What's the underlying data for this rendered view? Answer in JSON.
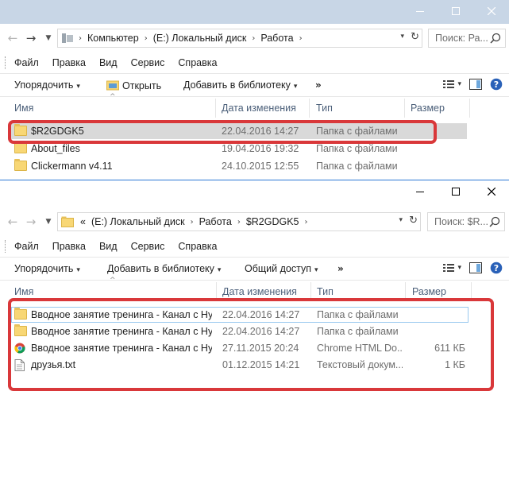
{
  "window_back": {
    "address": {
      "crumbs": [
        "Компьютер",
        "(E:) Локальный диск",
        "Работа"
      ],
      "search_placeholder": "Поиск: Ра..."
    },
    "menu": [
      "Файл",
      "Правка",
      "Вид",
      "Сервис",
      "Справка"
    ],
    "toolbar": {
      "organize": "Упорядочить",
      "open": "Открыть",
      "add_to_library": "Добавить в библиотеку",
      "more": "»"
    },
    "columns": {
      "name": "Имя",
      "date": "Дата изменения",
      "type": "Тип",
      "size": "Размер"
    },
    "rows": [
      {
        "name": "$R2GDGK5",
        "date": "22.04.2016 14:27",
        "type": "Папка с файлами",
        "size": "",
        "icon": "folder-icon"
      },
      {
        "name": "About_files",
        "date": "19.04.2016 19:32",
        "type": "Папка с файлами",
        "size": "",
        "icon": "folder-icon"
      },
      {
        "name": "Clickermann v4.11",
        "date": "24.10.2015 12:55",
        "type": "Папка с файлами",
        "size": "",
        "icon": "folder-icon"
      }
    ]
  },
  "window_front": {
    "address": {
      "overflow": "«",
      "crumbs": [
        "(E:) Локальный диск",
        "Работа",
        "$R2GDGK5"
      ],
      "search_placeholder": "Поиск: $R..."
    },
    "menu": [
      "Файл",
      "Правка",
      "Вид",
      "Сервис",
      "Справка"
    ],
    "toolbar": {
      "organize": "Упорядочить",
      "add_to_library": "Добавить в библиотеку",
      "share": "Общий доступ",
      "more": "»"
    },
    "columns": {
      "name": "Имя",
      "date": "Дата изменения",
      "type": "Тип",
      "size": "Размер"
    },
    "rows": [
      {
        "name": "Вводное занятие тренинга - Канал с Ну...",
        "date": "22.04.2016 14:27",
        "type": "Папка с файлами",
        "size": "",
        "icon": "folder-icon"
      },
      {
        "name": "Вводное занятие тренинга - Канал с Ну...",
        "date": "22.04.2016 14:27",
        "type": "Папка с файлами",
        "size": "",
        "icon": "folder-icon"
      },
      {
        "name": "Вводное занятие тренинга - Канал с Ну...",
        "date": "27.11.2015 20:24",
        "type": "Chrome HTML Do...",
        "size": "611 КБ",
        "icon": "chrome-icon"
      },
      {
        "name": "друзья.txt",
        "date": "01.12.2015 14:21",
        "type": "Текстовый докум...",
        "size": "1 КБ",
        "icon": "text-file-icon"
      }
    ]
  },
  "colors": {
    "highlight_border": "#d9383a",
    "active_title_border": "#2b79d6",
    "inactive_title_bg": "#c8d6e6",
    "folder": "#f8d775"
  }
}
